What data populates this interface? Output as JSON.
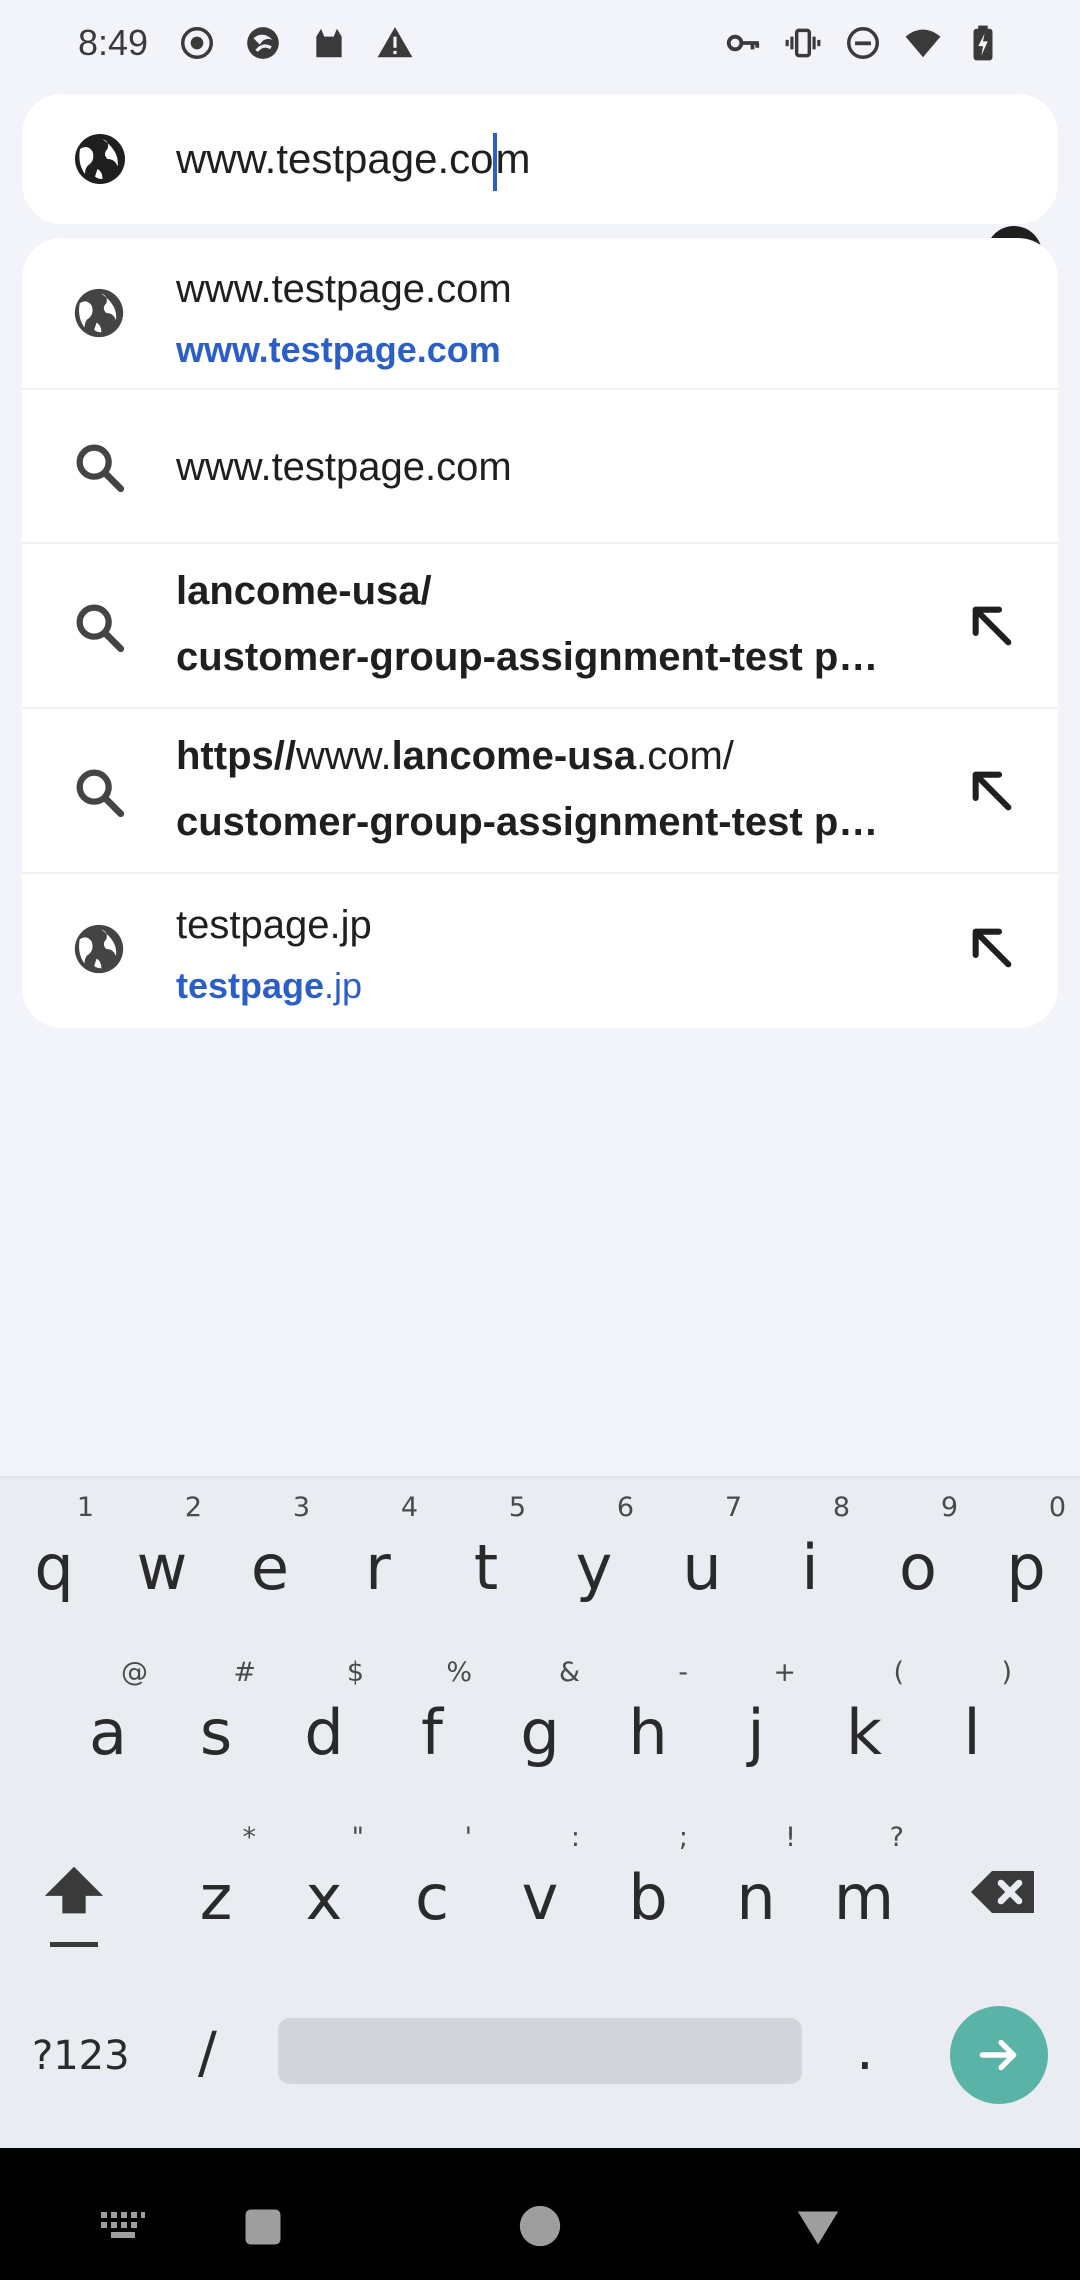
{
  "status_bar": {
    "time": "8:49",
    "left_icons": [
      "record-icon",
      "browser-icon",
      "cat-icon",
      "warning-icon"
    ],
    "right_icons": [
      "key-icon",
      "vibrate-icon",
      "dnd-icon",
      "wifi-icon",
      "battery-icon"
    ]
  },
  "omnibox": {
    "url_before_caret": "www.testpage.co",
    "url_after_caret": "m",
    "leading_icon": "globe-icon",
    "clear_icon": "clear-icon"
  },
  "suggestions": [
    {
      "icon": "globe-icon",
      "line1": "www.testpage.com",
      "line2": "www.testpage.com"
    },
    {
      "icon": "search-icon",
      "line1": "www.testpage.com"
    },
    {
      "icon": "search-icon",
      "line1": "lancome-usa/",
      "line2": "customer-group-assignment-test p…",
      "action": "arrow-up-left-icon"
    },
    {
      "icon": "search-icon",
      "line1_parts": [
        "https//",
        "www.",
        "lancome-usa",
        ".com/"
      ],
      "line2": "customer-group-assignment-test p…",
      "action": "arrow-up-left-icon"
    },
    {
      "icon": "globe-icon",
      "line1": "testpage.jp",
      "line2_parts": [
        "testpage",
        ".jp"
      ],
      "action": "arrow-up-left-icon"
    }
  ],
  "keyboard": {
    "row1": [
      {
        "key": "q",
        "hint": "1"
      },
      {
        "key": "w",
        "hint": "2"
      },
      {
        "key": "e",
        "hint": "3"
      },
      {
        "key": "r",
        "hint": "4"
      },
      {
        "key": "t",
        "hint": "5"
      },
      {
        "key": "y",
        "hint": "6"
      },
      {
        "key": "u",
        "hint": "7"
      },
      {
        "key": "i",
        "hint": "8"
      },
      {
        "key": "o",
        "hint": "9"
      },
      {
        "key": "p",
        "hint": "0"
      }
    ],
    "row2": [
      {
        "key": "a",
        "hint": "@"
      },
      {
        "key": "s",
        "hint": "#"
      },
      {
        "key": "d",
        "hint": "$"
      },
      {
        "key": "f",
        "hint": "%"
      },
      {
        "key": "g",
        "hint": "&"
      },
      {
        "key": "h",
        "hint": "-"
      },
      {
        "key": "j",
        "hint": "+"
      },
      {
        "key": "k",
        "hint": "("
      },
      {
        "key": "l",
        "hint": ")"
      }
    ],
    "row3": [
      {
        "key": "z",
        "hint": "*"
      },
      {
        "key": "x",
        "hint": "\""
      },
      {
        "key": "c",
        "hint": "'"
      },
      {
        "key": "v",
        "hint": ":"
      },
      {
        "key": "b",
        "hint": ";"
      },
      {
        "key": "n",
        "hint": "!"
      },
      {
        "key": "m",
        "hint": "?"
      }
    ],
    "symbols_label": "?123",
    "slash_label": "/",
    "period_label": "."
  },
  "colors": {
    "accent_blue": "#2b5fc7",
    "enter_teal": "#5ab3a7",
    "background": "#f3f4f9"
  }
}
